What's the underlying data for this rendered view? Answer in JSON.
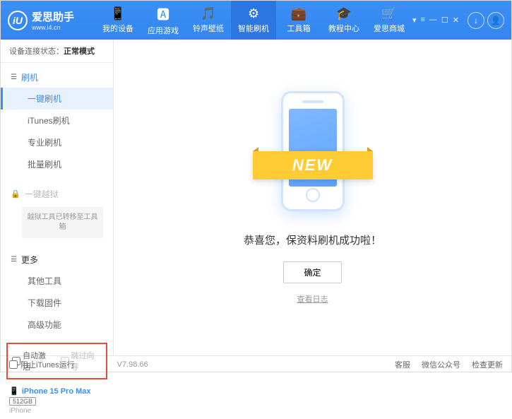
{
  "header": {
    "logo_glyph": "iU",
    "title": "爱思助手",
    "url": "www.i4.cn",
    "tabs": [
      {
        "icon": "📱",
        "label": "我的设备"
      },
      {
        "icon": "🅰",
        "label": "应用游戏"
      },
      {
        "icon": "🎵",
        "label": "铃声壁纸"
      },
      {
        "icon": "⚙",
        "label": "智能刷机"
      },
      {
        "icon": "💼",
        "label": "工具箱"
      },
      {
        "icon": "🎓",
        "label": "教程中心"
      },
      {
        "icon": "🛒",
        "label": "爱思商城"
      }
    ],
    "active_tab_index": 3
  },
  "sidebar": {
    "conn_label": "设备连接状态：",
    "conn_mode": "正常模式",
    "sections": {
      "flash": {
        "title": "刷机",
        "items": [
          "一键刷机",
          "iTunes刷机",
          "专业刷机",
          "批量刷机"
        ],
        "active_index": 0
      },
      "jailbreak": {
        "title": "一键越狱",
        "note": "越狱工具已转移至工具箱"
      },
      "more": {
        "title": "更多",
        "items": [
          "其他工具",
          "下载固件",
          "高级功能"
        ]
      }
    },
    "checkboxes": {
      "auto_activate": "自动激活",
      "skip_guide": "跳过向导"
    },
    "device": {
      "name": "iPhone 15 Pro Max",
      "storage": "512GB",
      "type": "iPhone"
    }
  },
  "main": {
    "ribbon_text": "NEW",
    "success_message": "恭喜您，保资料刷机成功啦！",
    "ok_button": "确定",
    "log_link": "查看日志"
  },
  "footer": {
    "block_itunes": "阻止iTunes运行",
    "version": "V7.98.66",
    "links": [
      "客服",
      "微信公众号",
      "检查更新"
    ]
  }
}
